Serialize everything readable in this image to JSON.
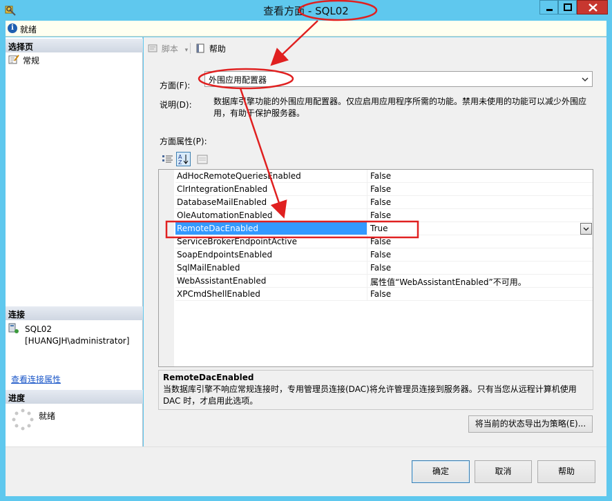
{
  "window": {
    "title": "查看方面 - SQL02",
    "status_text": "就绪"
  },
  "left_panel": {
    "select_page_header": "选择页",
    "pages": [
      {
        "label": "常规"
      }
    ],
    "connection_header": "连接",
    "server": "SQL02",
    "user": "[HUANGJH\\administrator]",
    "view_connection_link": "查看连接属性",
    "progress_header": "进度",
    "progress_status": "就绪"
  },
  "toolbar": {
    "script_label": "脚本",
    "help_label": "帮助"
  },
  "facet": {
    "label": "方面(F):",
    "value": "外围应用配置器",
    "description_label": "说明(D):",
    "description": "数据库引擎功能的外围应用配置器。仅应启用应用程序所需的功能。禁用未使用的功能可以减少外围应用，有助于保护服务器。"
  },
  "properties": {
    "label": "方面属性(P):",
    "rows": [
      {
        "name": "AdHocRemoteQueriesEnabled",
        "value": "False"
      },
      {
        "name": "ClrIntegrationEnabled",
        "value": "False"
      },
      {
        "name": "DatabaseMailEnabled",
        "value": "False"
      },
      {
        "name": "OleAutomationEnabled",
        "value": "False"
      },
      {
        "name": "RemoteDacEnabled",
        "value": "True"
      },
      {
        "name": "ServiceBrokerEndpointActive",
        "value": "False"
      },
      {
        "name": "SoapEndpointsEnabled",
        "value": "False"
      },
      {
        "name": "SqlMailEnabled",
        "value": "False"
      },
      {
        "name": "WebAssistantEnabled",
        "value": "属性值“WebAssistantEnabled”不可用。"
      },
      {
        "name": "XPCmdShellEnabled",
        "value": "False"
      }
    ],
    "selected_index": 4,
    "help_title": "RemoteDacEnabled",
    "help_text": "当数据库引擎不响应常规连接时，专用管理员连接(DAC)将允许管理员连接到服务器。只有当您从远程计算机使用 DAC 时，才启用此选项。"
  },
  "buttons": {
    "export": "将当前的状态导出为策略(E)...",
    "ok": "确定",
    "cancel": "取消",
    "help": "帮助"
  },
  "colors": {
    "titlebar": "#5fc8ee",
    "selection": "#3399ff",
    "annotation": "#e02020"
  }
}
